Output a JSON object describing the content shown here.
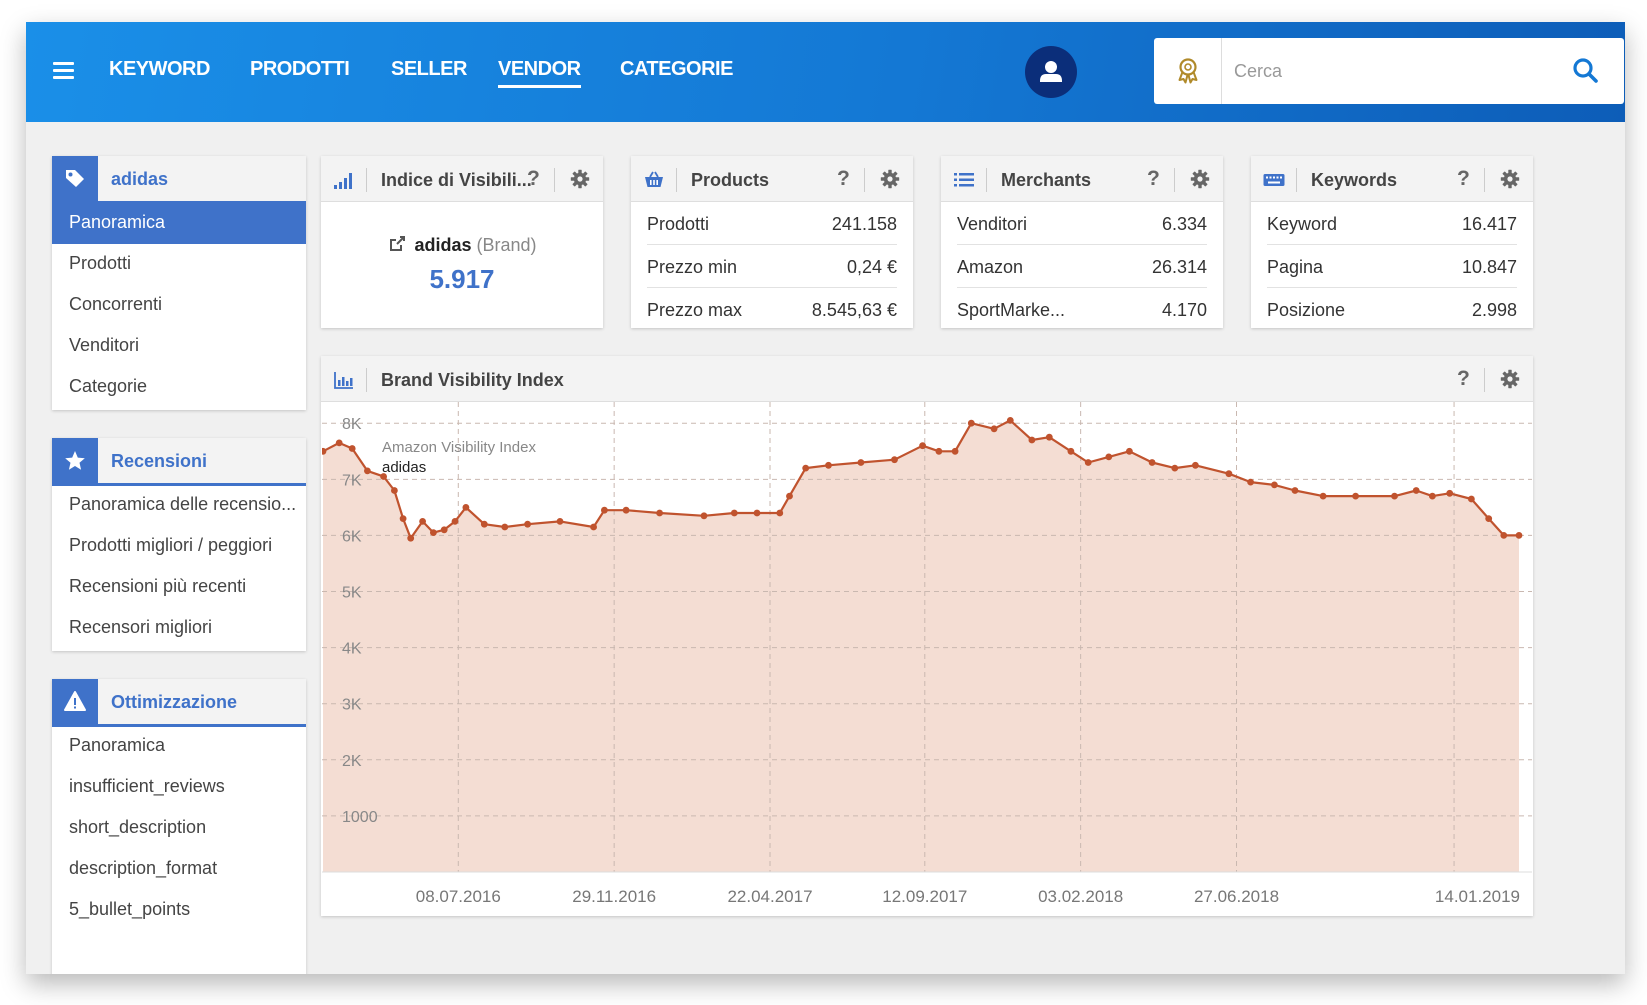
{
  "topbar": {
    "menu_icon": "hamburger-icon",
    "nav": [
      {
        "label": "KEYWORD",
        "active": false
      },
      {
        "label": "PRODOTTI",
        "active": false
      },
      {
        "label": "SELLER",
        "active": false
      },
      {
        "label": "VENDOR",
        "active": true
      },
      {
        "label": "CATEGORIE",
        "active": false
      }
    ],
    "search": {
      "placeholder": "Cerca",
      "value": ""
    }
  },
  "colors": {
    "primary": "#1478d4",
    "accent": "#3f72c9",
    "chart_line": "#c0532e",
    "chart_fill": "#f4ddd3"
  },
  "sidebar": [
    {
      "title": "adidas",
      "icon": "tag-icon",
      "items": [
        {
          "label": "Panoramica",
          "active": true
        },
        {
          "label": "Prodotti",
          "active": false
        },
        {
          "label": "Concorrenti",
          "active": false
        },
        {
          "label": "Venditori",
          "active": false
        },
        {
          "label": "Categorie",
          "active": false
        }
      ]
    },
    {
      "title": "Recensioni",
      "icon": "star-icon",
      "items": [
        {
          "label": "Panoramica delle recensio...",
          "active": false
        },
        {
          "label": "Prodotti migliori / peggiori",
          "active": false
        },
        {
          "label": "Recensioni più recenti",
          "active": false
        },
        {
          "label": "Recensori migliori",
          "active": false
        }
      ]
    },
    {
      "title": "Ottimizzazione",
      "icon": "warning-icon",
      "items": [
        {
          "label": "Panoramica",
          "active": false
        },
        {
          "label": "insufficient_reviews",
          "active": false
        },
        {
          "label": "short_description",
          "active": false
        },
        {
          "label": "description_format",
          "active": false
        },
        {
          "label": "5_bullet_points",
          "active": false
        }
      ]
    }
  ],
  "visibility_card": {
    "title": "Indice di Visibili...",
    "help": "?",
    "brand": "adidas",
    "brand_type": "(Brand)",
    "value": "5.917"
  },
  "stat_cards": [
    {
      "title": "Products",
      "icon": "basket-icon",
      "help": "?",
      "rows": [
        {
          "label": "Prodotti",
          "value": "241.158"
        },
        {
          "label": "Prezzo min",
          "value": "0,24 €"
        },
        {
          "label": "Prezzo max",
          "value": "8.545,63 €"
        }
      ]
    },
    {
      "title": "Merchants",
      "icon": "list-icon",
      "help": "?",
      "rows": [
        {
          "label": "Venditori",
          "value": "6.334"
        },
        {
          "label": "Amazon",
          "value": "26.314"
        },
        {
          "label": "SportMarke...",
          "value": "4.170"
        }
      ]
    },
    {
      "title": "Keywords",
      "icon": "keyboard-icon",
      "help": "?",
      "rows": [
        {
          "label": "Keyword",
          "value": "16.417"
        },
        {
          "label": "Pagina",
          "value": "10.847"
        },
        {
          "label": "Posizione",
          "value": "2.998"
        }
      ]
    }
  ],
  "chart_card": {
    "title": "Brand Visibility Index",
    "help": "?"
  },
  "chart_data": {
    "type": "area",
    "title": "Brand Visibility Index",
    "legend": {
      "title": "Amazon Visibility Index",
      "series": "adidas",
      "position": "top-left"
    },
    "yticks": [
      "8K",
      "7K",
      "6K",
      "5K",
      "4K",
      "3K",
      "2K",
      "1000"
    ],
    "ytick_values": [
      8000,
      7000,
      6000,
      5000,
      4000,
      3000,
      2000,
      1000
    ],
    "ylim": [
      0,
      8200
    ],
    "xlim": [
      "2016-03-05",
      "2019-03-15"
    ],
    "xticks": [
      "08.07.2016",
      "29.11.2016",
      "22.04.2017",
      "12.09.2017",
      "03.02.2018",
      "27.06.2018",
      "14.01.2019"
    ],
    "xtick_dates": [
      "2016-07-08",
      "2016-11-29",
      "2017-04-22",
      "2017-09-12",
      "2018-02-03",
      "2018-06-27",
      "2019-01-14"
    ],
    "grid": true,
    "series": [
      {
        "name": "adidas",
        "points": [
          [
            "2016-03-05",
            7500
          ],
          [
            "2016-03-20",
            7650
          ],
          [
            "2016-04-01",
            7550
          ],
          [
            "2016-04-15",
            7150
          ],
          [
            "2016-04-30",
            7050
          ],
          [
            "2016-05-10",
            6800
          ],
          [
            "2016-05-18",
            6300
          ],
          [
            "2016-05-25",
            5950
          ],
          [
            "2016-06-05",
            6250
          ],
          [
            "2016-06-15",
            6050
          ],
          [
            "2016-06-25",
            6100
          ],
          [
            "2016-07-05",
            6250
          ],
          [
            "2016-07-15",
            6500
          ],
          [
            "2016-08-01",
            6200
          ],
          [
            "2016-08-20",
            6150
          ],
          [
            "2016-09-10",
            6200
          ],
          [
            "2016-10-10",
            6250
          ],
          [
            "2016-11-10",
            6150
          ],
          [
            "2016-11-20",
            6450
          ],
          [
            "2016-12-10",
            6450
          ],
          [
            "2017-01-10",
            6400
          ],
          [
            "2017-02-20",
            6350
          ],
          [
            "2017-03-20",
            6400
          ],
          [
            "2017-04-10",
            6400
          ],
          [
            "2017-05-01",
            6400
          ],
          [
            "2017-05-10",
            6700
          ],
          [
            "2017-05-25",
            7200
          ],
          [
            "2017-06-15",
            7250
          ],
          [
            "2017-07-15",
            7300
          ],
          [
            "2017-08-15",
            7350
          ],
          [
            "2017-09-10",
            7600
          ],
          [
            "2017-09-25",
            7500
          ],
          [
            "2017-10-10",
            7500
          ],
          [
            "2017-10-25",
            8000
          ],
          [
            "2017-11-15",
            7900
          ],
          [
            "2017-11-30",
            8050
          ],
          [
            "2017-12-20",
            7700
          ],
          [
            "2018-01-05",
            7750
          ],
          [
            "2018-01-25",
            7500
          ],
          [
            "2018-02-10",
            7300
          ],
          [
            "2018-03-01",
            7400
          ],
          [
            "2018-03-20",
            7500
          ],
          [
            "2018-04-10",
            7300
          ],
          [
            "2018-05-01",
            7200
          ],
          [
            "2018-05-20",
            7250
          ],
          [
            "2018-06-20",
            7100
          ],
          [
            "2018-07-10",
            6950
          ],
          [
            "2018-08-01",
            6900
          ],
          [
            "2018-08-20",
            6800
          ],
          [
            "2018-09-15",
            6700
          ],
          [
            "2018-10-15",
            6700
          ],
          [
            "2018-11-20",
            6700
          ],
          [
            "2018-12-10",
            6800
          ],
          [
            "2018-12-25",
            6700
          ],
          [
            "2019-01-10",
            6750
          ],
          [
            "2019-01-30",
            6650
          ],
          [
            "2019-02-15",
            6300
          ],
          [
            "2019-03-01",
            6000
          ],
          [
            "2019-03-15",
            6000
          ]
        ]
      }
    ]
  }
}
